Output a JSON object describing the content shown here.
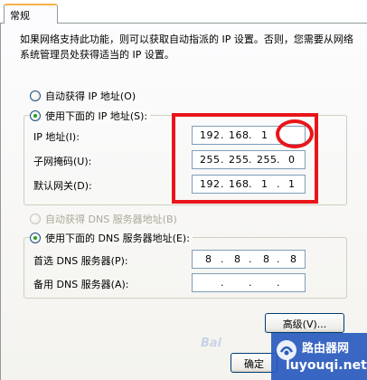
{
  "tab": {
    "label": "常规"
  },
  "description": "如果网络支持此功能，则可以获取自动指派的 IP 设置。否则，您需要从网络系统管理员处获得适当的 IP 设置。",
  "ip_mode": {
    "auto_label": "自动获得 IP 地址(O)",
    "manual_label": "使用下面的 IP 地址(S):",
    "selected": "manual"
  },
  "ip_fields": {
    "ip_label": "IP 地址(I):",
    "ip_value": [
      "192",
      "168",
      "1",
      ""
    ],
    "mask_label": "子网掩码(U):",
    "mask_value": [
      "255",
      "255",
      "255",
      "0"
    ],
    "gateway_label": "默认网关(D):",
    "gateway_value": [
      "192",
      "168",
      "1",
      "1"
    ]
  },
  "dns_mode": {
    "auto_label": "自动获得 DNS 服务器地址(B)",
    "manual_label": "使用下面的 DNS 服务器地址(E):",
    "selected": "manual"
  },
  "dns_fields": {
    "preferred_label": "首选 DNS 服务器(P):",
    "preferred_value": [
      "8",
      "8",
      "8",
      "8"
    ],
    "alternate_label": "备用 DNS 服务器(A):",
    "alternate_value": [
      "",
      "",
      "",
      ""
    ]
  },
  "buttons": {
    "advanced": "高级(V)...",
    "ok": "确定"
  },
  "watermark": {
    "brand": "Bai",
    "site_cn": "路由器网",
    "site_url": "luyouqi.net"
  },
  "annotation_color": "#e8151a"
}
